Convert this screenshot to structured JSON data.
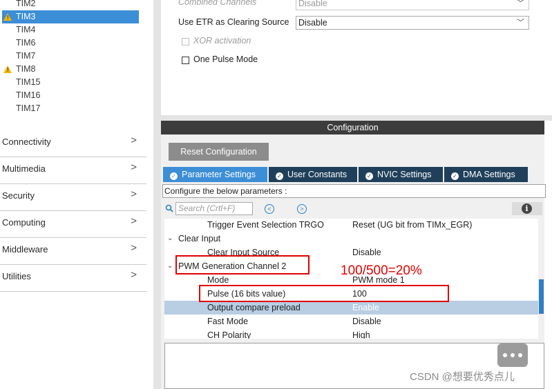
{
  "sidebar": {
    "timers": [
      {
        "label": "TIM2",
        "warning": false,
        "selected": false
      },
      {
        "label": "TIM3",
        "warning": true,
        "selected": true
      },
      {
        "label": "TIM4",
        "warning": false,
        "selected": false
      },
      {
        "label": "TIM6",
        "warning": false,
        "selected": false
      },
      {
        "label": "TIM7",
        "warning": false,
        "selected": false
      },
      {
        "label": "TIM8",
        "warning": true,
        "selected": false
      },
      {
        "label": "TIM15",
        "warning": false,
        "selected": false
      },
      {
        "label": "TIM16",
        "warning": false,
        "selected": false
      },
      {
        "label": "TIM17",
        "warning": false,
        "selected": false
      }
    ],
    "categories": [
      {
        "label": "Connectivity"
      },
      {
        "label": "Multimedia"
      },
      {
        "label": "Security"
      },
      {
        "label": "Computing"
      },
      {
        "label": "Middleware"
      },
      {
        "label": "Utilities"
      }
    ],
    "warning_glyph": "!",
    "chevron_glyph": ">"
  },
  "mode": {
    "combined_channels_label": "Combined Channels",
    "combined_channels_value": "Disable",
    "etr_label": "Use ETR as Clearing Source",
    "etr_value": "Disable",
    "xor_label": "XOR activation",
    "one_pulse_label": "One Pulse Mode"
  },
  "config": {
    "header": "Configuration",
    "reset_button": "Reset Configuration",
    "tabs": [
      {
        "label": "Parameter Settings",
        "active": true
      },
      {
        "label": "User Constants",
        "active": false
      },
      {
        "label": "NVIC Settings",
        "active": false
      },
      {
        "label": "DMA Settings",
        "active": false
      }
    ],
    "tab_check_glyph": "✓",
    "instructions": "Configure the below parameters :",
    "search_placeholder": "Search (Crtl+F)",
    "info_glyph": "i",
    "params": [
      {
        "type": "param",
        "key": "Trigger Event Selection TRGO",
        "value": "Reset (UG bit from TIMx_EGR)",
        "highlight": false
      },
      {
        "type": "group",
        "key": "Clear Input"
      },
      {
        "type": "param",
        "key": "Clear Input Source",
        "value": "Disable",
        "highlight": false
      },
      {
        "type": "group",
        "key": "PWM Generation Channel 2"
      },
      {
        "type": "param",
        "key": "Mode",
        "value": "PWM mode 1",
        "highlight": false
      },
      {
        "type": "param",
        "key": "Pulse (16 bits value)",
        "value": "100",
        "highlight": false
      },
      {
        "type": "param",
        "key": "Output compare preload",
        "value": "Enable",
        "highlight": true
      },
      {
        "type": "param",
        "key": "Fast Mode",
        "value": "Disable",
        "highlight": false
      },
      {
        "type": "param",
        "key": "CH Polarity",
        "value": "High",
        "highlight": false
      }
    ]
  },
  "annotation": "100/500=20%",
  "watermark": "CSDN @想要优秀点儿",
  "colors": {
    "accent": "#3c8ed6",
    "tab_dark": "#1f3f5a",
    "annotation": "#e00000",
    "warning": "#f2b500"
  }
}
